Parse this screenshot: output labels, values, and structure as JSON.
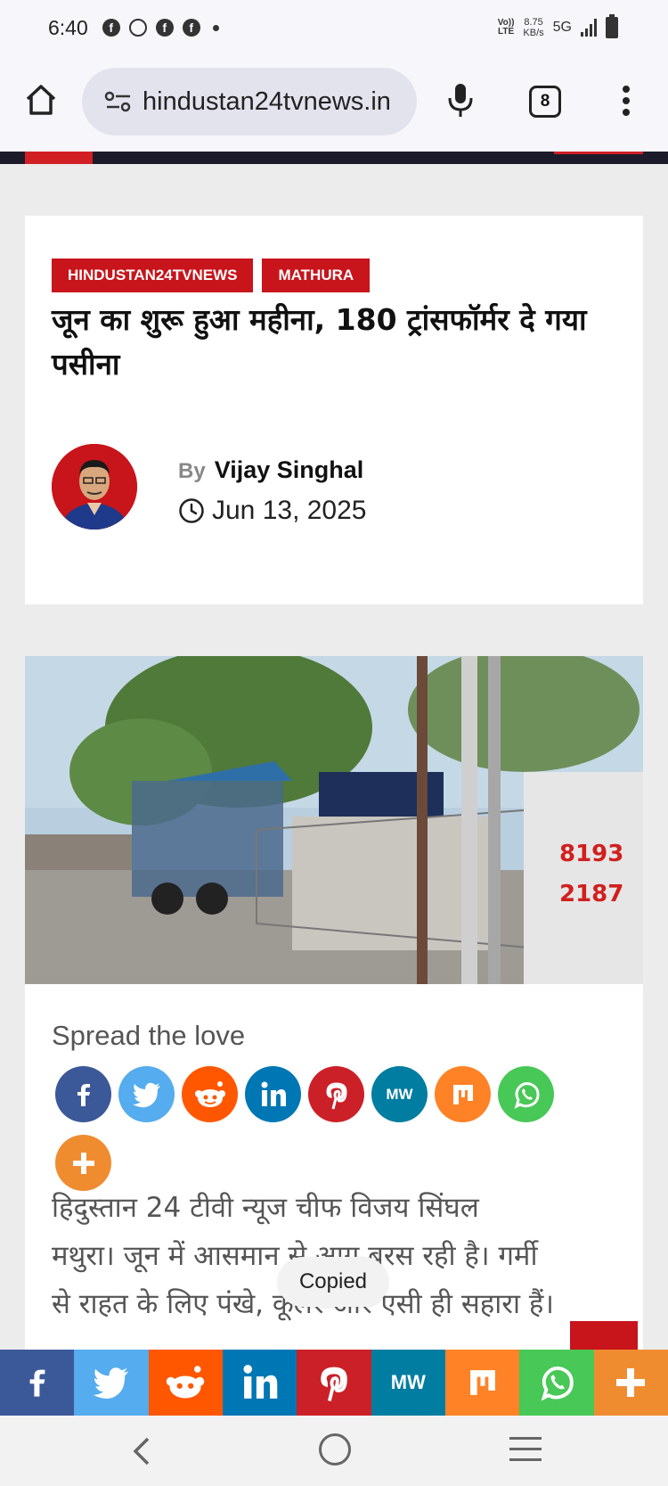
{
  "status_bar": {
    "time": "6:40",
    "volte_top": "Vo))",
    "volte_bottom": "LTE",
    "speed_top": "8.75",
    "speed_bottom": "KB/s",
    "network": "5G"
  },
  "browser": {
    "url": "hindustan24tvnews.in",
    "tab_count": "8"
  },
  "article": {
    "categories": [
      "HINDUSTAN24TVNEWS",
      "MATHURA"
    ],
    "headline": "जून का शुरू हुआ महीना, 180 ट्रांसफॉर्मर दे गया पसीना",
    "by_label": "By",
    "author": "Vijay Singhal",
    "date": "Jun 13, 2025"
  },
  "share": {
    "title": "Spread the love",
    "buttons": [
      "facebook",
      "twitter",
      "reddit",
      "linkedin",
      "pinterest",
      "mewe",
      "mix",
      "whatsapp",
      "more"
    ],
    "colors": {
      "facebook": "#3b5998",
      "twitter": "#55acee",
      "reddit": "#ff5700",
      "linkedin": "#0077b5",
      "pinterest": "#cb2027",
      "mewe": "#007da1",
      "mix": "#ff8226",
      "whatsapp": "#48c857",
      "more": "#f08c30"
    },
    "mewe_label": "MW"
  },
  "body": {
    "lines": [
      "हिदुस्तान 24 टीवी न्यूज चीफ विजय सिंघल",
      "मथुरा। जून में आसमान से आग बरस रही है। गर्मी",
      "से राहत के लिए पंखे, कूलर और एसी ही सहारा हैं।"
    ]
  },
  "toast": {
    "text": "Copied"
  }
}
